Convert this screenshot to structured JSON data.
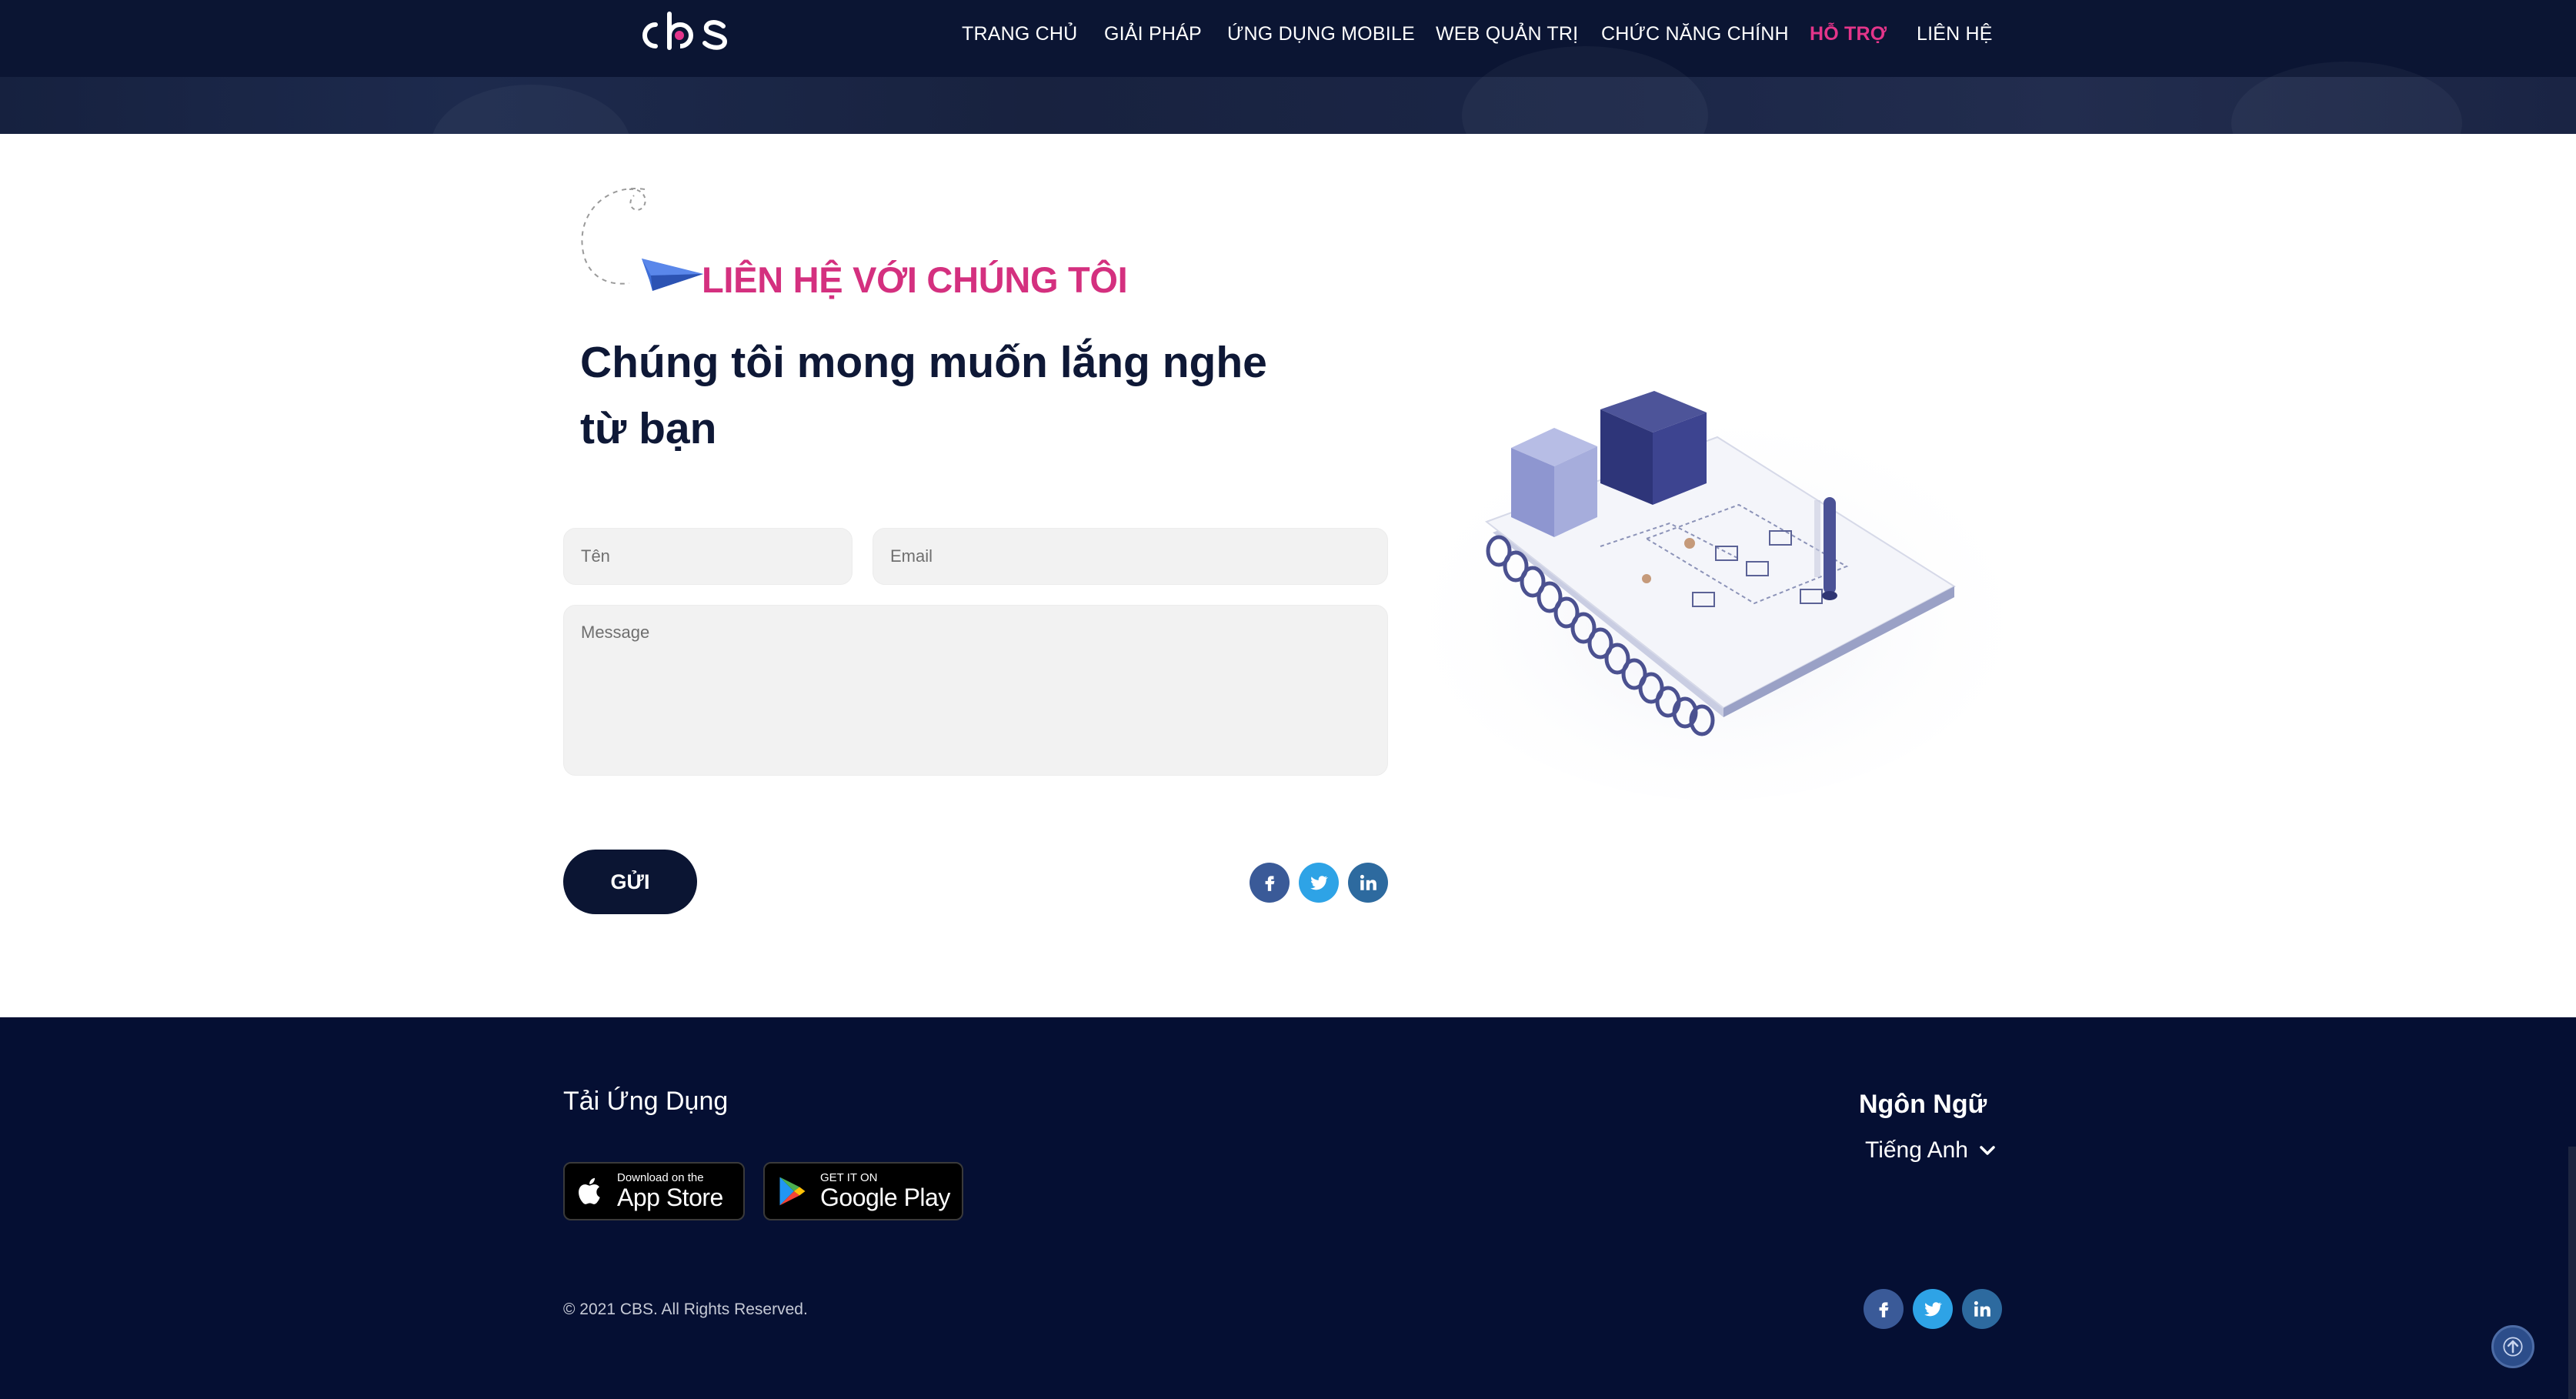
{
  "header": {
    "logo_text": "cbs",
    "nav": [
      {
        "label": "TRANG CHỦ"
      },
      {
        "label": "GIẢI PHÁP"
      },
      {
        "label": "ỨNG DỤNG MOBILE"
      },
      {
        "label": "WEB QUẢN TRỊ"
      },
      {
        "label": "CHỨC NĂNG CHÍNH"
      },
      {
        "label": "HỖ TRỢ",
        "active": true
      },
      {
        "label": "LIÊN HỆ"
      }
    ]
  },
  "contact": {
    "kicker": "LIÊN HỆ VỚI CHÚNG TÔI",
    "headline": "Chúng tôi mong muốn lắng nghe từ bạn",
    "name_placeholder": "Tên",
    "email_placeholder": "Email",
    "message_placeholder": "Message",
    "send_label": "GỬI",
    "social": [
      "facebook-icon",
      "twitter-icon",
      "linkedin-icon"
    ]
  },
  "footer": {
    "app_title": "Tải Ứng Dụng",
    "app_store": {
      "small": "Download on the",
      "big": "App Store"
    },
    "google_play": {
      "small": "GET IT ON",
      "big": "Google Play"
    },
    "language_title": "Ngôn Ngữ",
    "language_value": "Tiếng Anh",
    "copyright": "© 2021 CBS. All Rights Reserved.",
    "social": [
      "facebook-icon",
      "twitter-icon",
      "linkedin-icon"
    ]
  },
  "colors": {
    "navy": "#0b1533",
    "footer_bg": "#050f33",
    "accent_pink": "#e4358a",
    "field_bg": "#f2f2f2"
  }
}
